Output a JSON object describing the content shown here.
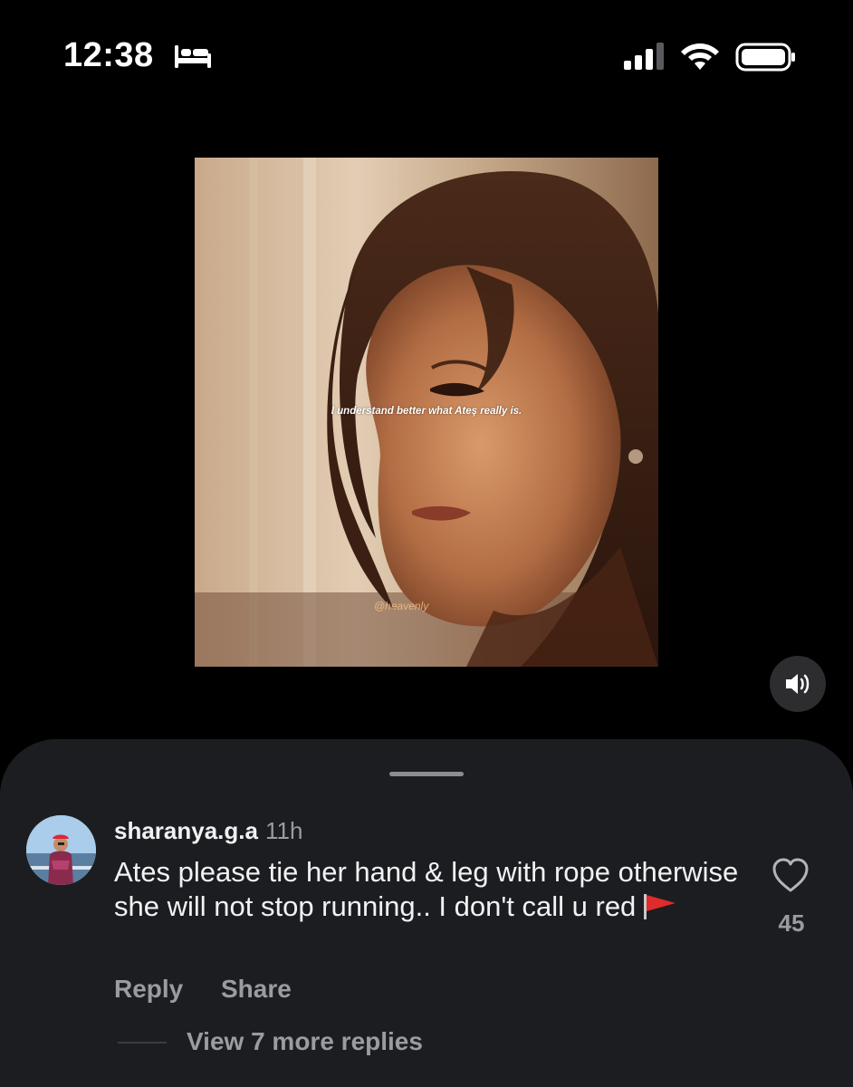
{
  "status_bar": {
    "time": "12:38",
    "focus_icon": "bed-icon",
    "signal_icon": "cellular-signal-icon",
    "wifi_icon": "wifi-icon",
    "battery_icon": "battery-icon"
  },
  "video": {
    "caption": "I understand better what Ateş really is.",
    "watermark": "@heavenly",
    "sound_icon": "speaker-icon"
  },
  "comments": {
    "items": [
      {
        "username": "sharanya.g.a",
        "time": "11h",
        "text": "Ates please tie her hand & leg with rope otherwise she will not stop running.. I don't call u red",
        "emoji_icon": "red-flag-icon",
        "likes": "45",
        "reply_label": "Reply",
        "share_label": "Share",
        "view_replies_label": "View 7 more replies"
      }
    ]
  },
  "colors": {
    "background": "#000000",
    "sheet": "#1c1d21",
    "secondary_text": "#9a9ca2",
    "primary_text": "#f2f2f4"
  }
}
